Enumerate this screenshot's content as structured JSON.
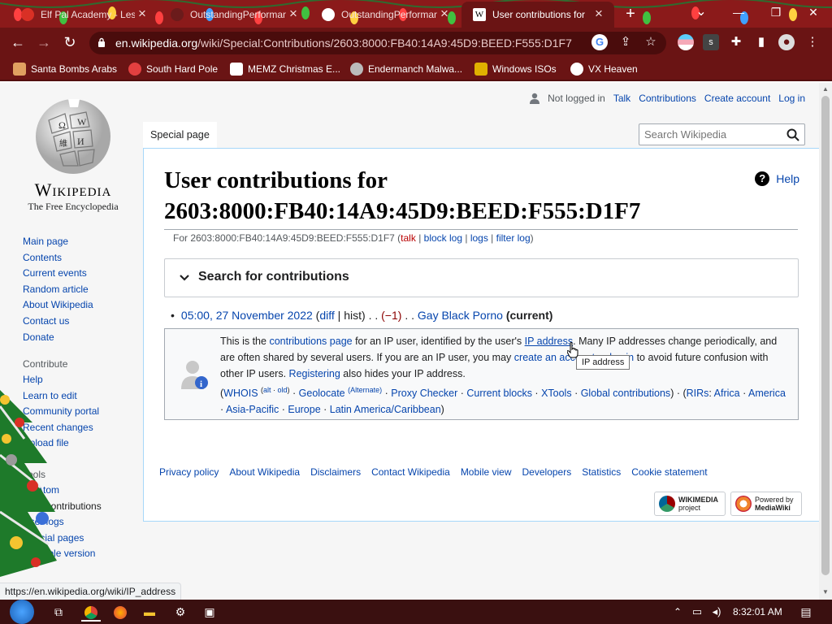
{
  "browser": {
    "tabs": [
      {
        "title": "Elf Pal Academy - Lesso",
        "close": "×",
        "active": false,
        "favicon_color": "#d93025"
      },
      {
        "title": "OutstandingPerformance",
        "close": "×",
        "active": false,
        "favicon_color": "#6b1b1b"
      },
      {
        "title": "OutstandingPerformance",
        "close": "×",
        "active": false,
        "favicon_color": "#ffffff"
      },
      {
        "title": "User contributions for",
        "close": "×",
        "active": true,
        "favicon_color": "#ffffff"
      }
    ],
    "new_tab": "+",
    "window_controls": {
      "minimize": "—",
      "maximize": "❐",
      "close": "✕",
      "tabsearch": "⌄"
    },
    "url_host": "en.wikipedia.org",
    "url_path": "/wiki/Special:Contributions/2603:8000:FB40:14A9:45D9:BEED:F555:D1F7",
    "bookmarks": [
      {
        "label": "Santa Bombs Arabs",
        "icon_color": "#e0a060"
      },
      {
        "label": "South Hard Pole",
        "icon_color": "#e34040"
      },
      {
        "label": "MEMZ Christmas E...",
        "icon_color": "#ffffff"
      },
      {
        "label": "Endermanch Malwa...",
        "icon_color": "#bbbbbb"
      },
      {
        "label": "Windows ISOs",
        "icon_color": "#e0b000"
      },
      {
        "label": "VX Heaven",
        "icon_color": "#ffffff"
      }
    ],
    "status_url": "https://en.wikipedia.org/wiki/IP_address"
  },
  "wiki": {
    "logo_wordmark": "Wikipedia",
    "logo_tagline": "The Free Encyclopedia",
    "nav": [
      "Main page",
      "Contents",
      "Current events",
      "Random article",
      "About Wikipedia",
      "Contact us",
      "Donate"
    ],
    "contribute_heading": "Contribute",
    "contribute": [
      "Help",
      "Learn to edit",
      "Community portal",
      "Recent changes",
      "Upload file"
    ],
    "tools_heading": "Tools",
    "tools": [
      "Atom",
      "User contributions",
      "User logs",
      "Special pages",
      "Printable version"
    ],
    "personal": {
      "not_logged_in": "Not logged in",
      "talk": "Talk",
      "contributions": "Contributions",
      "create_account": "Create account",
      "login": "Log in"
    },
    "special_tab": "Special page",
    "search_placeholder": "Search Wikipedia",
    "title": "User contributions for 2603:8000:FB40:14A9:45D9:BEED:F555:D1F7",
    "help": "Help",
    "subline": {
      "prefix": "For 2603:8000:FB40:14A9:45D9:BEED:F555:D1F7 (",
      "talk": "talk",
      "block_log": "block log",
      "logs": "logs",
      "filter_log": "filter log",
      "suffix": ")"
    },
    "search_contribs": "Search for contributions",
    "entry": {
      "time": "05:00, 27 November 2022",
      "diff": "diff",
      "hist": "hist",
      "size": "(−1)",
      "page": "Gay Black Porno",
      "current": "(current)"
    },
    "info": {
      "t1": "This is the ",
      "contributions_page": "contributions page",
      "t2": " for an IP user, identified by the user's ",
      "ip_address": "IP address",
      "t3": ". Many IP addresses change periodically, and are often shared by several users. If you are an IP user, you may ",
      "create_account": "create an account",
      "t4": " or ",
      "log_in": "log in",
      "t5": " to avoid future confusion with other IP users. ",
      "registering": "Registering",
      "t6": " also hides your IP address.",
      "whois": "WHOIS",
      "alt": "alt",
      "old": "old",
      "geolocate": "Geolocate",
      "alternate": "(Alternate)",
      "proxy": "Proxy Checker",
      "blocks": "Current blocks",
      "xtools": "XTools",
      "global": "Global contributions",
      "rirs": "RIRs",
      "africa": "Africa",
      "america": "America",
      "asia": "Asia-Pacific",
      "europe": "Europe",
      "latam": "Latin America/Caribbean"
    },
    "tooltip": "IP address",
    "footer": [
      "Privacy policy",
      "About Wikipedia",
      "Disclaimers",
      "Contact Wikipedia",
      "Mobile view",
      "Developers",
      "Statistics",
      "Cookie statement"
    ],
    "badge_wikimedia_1": "WIKIMEDIA",
    "badge_wikimedia_2": "project",
    "badge_mediawiki_1": "Powered by",
    "badge_mediawiki_2": "MediaWiki"
  },
  "taskbar": {
    "time": "8:32:01 AM"
  }
}
